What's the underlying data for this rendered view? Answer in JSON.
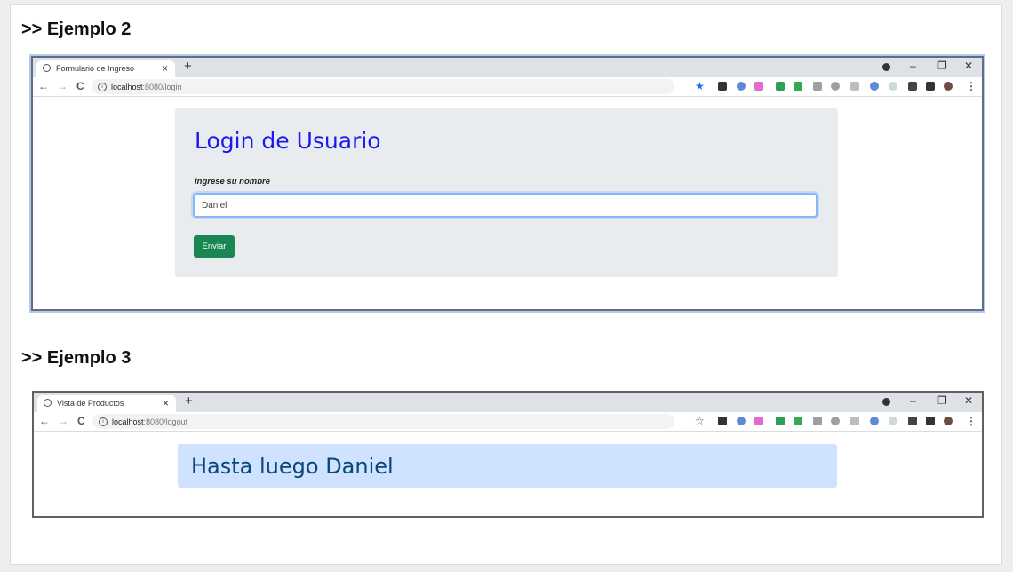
{
  "example2": {
    "heading": ">> Ejemplo 2",
    "browser": {
      "tab_title": "Formulario de Ingreso",
      "url_host": "localhost",
      "url_rest": ":8080/login"
    },
    "page": {
      "title": "Login de Usuario",
      "label": "Ingrese su nombre",
      "input_value": "Daniel",
      "submit_label": "Enviar"
    }
  },
  "example3": {
    "heading": ">> Ejemplo 3",
    "browser": {
      "tab_title": "Vista de Productos",
      "url_host": "localhost",
      "url_rest": ":8080/logout"
    },
    "page": {
      "message": "Hasta luego Daniel"
    }
  },
  "chrome": {
    "close_glyph": "×",
    "newtab_glyph": "+",
    "back_glyph": "←",
    "forward_glyph": "→",
    "reload_glyph": "C",
    "minimize_glyph": "–",
    "restore_glyph": "❐",
    "window_close_glyph": "✕",
    "menu_glyph": "⋮",
    "star_filled": "★",
    "star_outline": "☆",
    "info_glyph": "i"
  },
  "colors": {
    "login_title": "#1a1aee",
    "submit_button": "#198754",
    "alert_bg": "#cfe2ff",
    "alert_text": "#08467c"
  }
}
